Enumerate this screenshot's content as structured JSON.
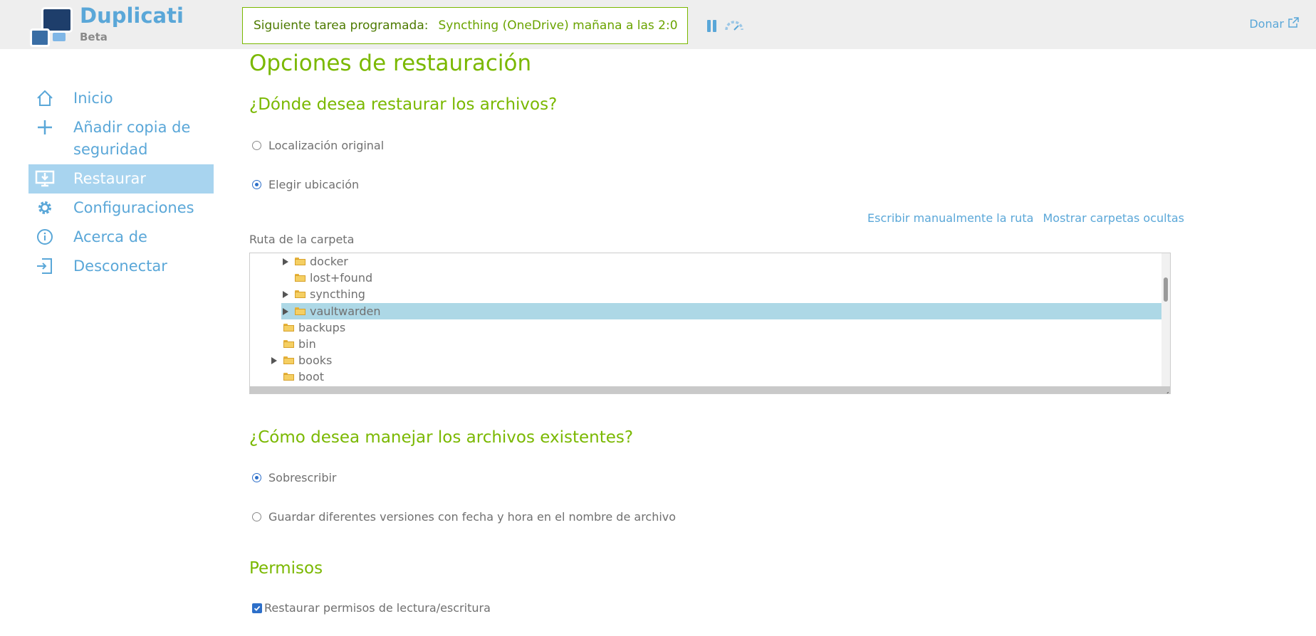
{
  "app": {
    "name": "Duplicati",
    "tagline": "Beta"
  },
  "header": {
    "scheduled_label": "Siguiente tarea programada:",
    "scheduled_value": "Syncthing (OneDrive) mañana a las 2:0",
    "donate": "Donar"
  },
  "sidebar": {
    "items": [
      {
        "label": "Inicio",
        "icon": "home-icon"
      },
      {
        "label": "Añadir copia de seguridad",
        "icon": "plus-icon"
      },
      {
        "label": "Restaurar",
        "icon": "restore-icon",
        "active": true
      },
      {
        "label": "Configuraciones",
        "icon": "gear-icon"
      },
      {
        "label": "Acerca de",
        "icon": "info-icon"
      },
      {
        "label": "Desconectar",
        "icon": "logout-icon"
      }
    ]
  },
  "main": {
    "title": "Opciones de restauración",
    "where_heading": "¿Dónde desea restaurar los archivos?",
    "where_options": [
      {
        "label": "Localización original",
        "checked": false
      },
      {
        "label": "Elegir ubicación",
        "checked": true
      }
    ],
    "link_manual": "Escribir manualmente la ruta",
    "link_hidden": "Mostrar carpetas ocultas",
    "folder_label": "Ruta de la carpeta",
    "tree": [
      {
        "name": "docker",
        "expandable": true,
        "selected": false
      },
      {
        "name": "lost+found",
        "expandable": false,
        "selected": false
      },
      {
        "name": "syncthing",
        "expandable": true,
        "selected": false
      },
      {
        "name": "vaultwarden",
        "expandable": true,
        "selected": true
      },
      {
        "name": "backups",
        "expandable": false,
        "selected": false
      },
      {
        "name": "bin",
        "expandable": false,
        "selected": false
      },
      {
        "name": "books",
        "expandable": true,
        "selected": false
      },
      {
        "name": "boot",
        "expandable": false,
        "selected": false
      }
    ],
    "existing_heading": "¿Cómo desea manejar los archivos existentes?",
    "existing_options": [
      {
        "label": "Sobrescribir",
        "checked": true
      },
      {
        "label": "Guardar diferentes versiones con fecha y hora en el nombre de archivo",
        "checked": false
      }
    ],
    "permissions_heading": "Permisos",
    "permissions_checkbox": "Restaurar permisos de lectura/escritura",
    "permissions_checked": true
  },
  "colors": {
    "accent": "#7ab800",
    "link": "#5aa7d8",
    "selection": "#add8e6",
    "nav_active": "#a8d4ef"
  }
}
